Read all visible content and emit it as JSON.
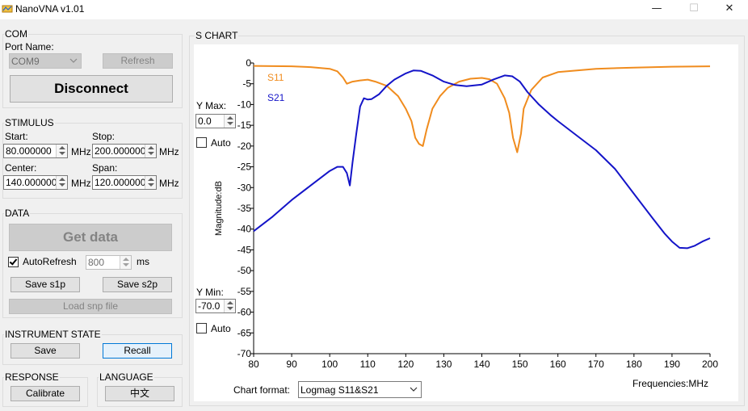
{
  "window": {
    "title": "NanoVNA v1.01",
    "controls": {
      "minimize": "—",
      "maximize": "☐",
      "close": "✕"
    }
  },
  "com": {
    "group": "COM",
    "port_label": "Port Name:",
    "port_value": "COM9",
    "refresh_label": "Refresh",
    "connect_label": "Disconnect"
  },
  "stimulus": {
    "group": "STIMULUS",
    "start_label": "Start:",
    "start_value": "80.000000",
    "stop_label": "Stop:",
    "stop_value": "200.000000",
    "center_label": "Center:",
    "center_value": "140.000000",
    "span_label": "Span:",
    "span_value": "120.000000",
    "unit": "MHz"
  },
  "data_group": {
    "group": "DATA",
    "get_data_label": "Get data",
    "autorefresh_label": "AutoRefresh",
    "autorefresh_checked": true,
    "interval_value": "800",
    "interval_unit": "ms",
    "save_s1p_label": "Save s1p",
    "save_s2p_label": "Save s2p",
    "load_snp_label": "Load snp file"
  },
  "instrument": {
    "group": "INSTRUMENT STATE",
    "save_label": "Save",
    "recall_label": "Recall"
  },
  "response": {
    "group": "RESPONSE",
    "calibrate_label": "Calibrate"
  },
  "language": {
    "group": "LANGUAGE",
    "button_label": "中文"
  },
  "schart": {
    "group": "S CHART",
    "ymax_label": "Y Max:",
    "ymax_value": "0.0",
    "ymin_label": "Y Min:",
    "ymin_value": "-70.0",
    "auto_label": "Auto",
    "chart_format_label": "Chart format:",
    "chart_format_value": "Logmag S11&S21"
  },
  "chart_data": {
    "type": "line",
    "title": "",
    "xlabel": "Frequencies:MHz",
    "ylabel": "Magnitude:dB",
    "xlim": [
      80,
      200
    ],
    "ylim": [
      -70,
      0
    ],
    "x_ticks": [
      80,
      90,
      100,
      110,
      120,
      130,
      140,
      150,
      160,
      170,
      180,
      190,
      200
    ],
    "y_ticks": [
      0,
      -5,
      -10,
      -15,
      -20,
      -25,
      -30,
      -35,
      -40,
      -45,
      -50,
      -55,
      -60,
      -65,
      -70
    ],
    "grid": false,
    "legend": "top-left",
    "series": [
      {
        "name": "S11",
        "color": "#f08c1e",
        "points": [
          [
            80,
            -0.7
          ],
          [
            90,
            -0.8
          ],
          [
            95,
            -1.0
          ],
          [
            100,
            -1.4
          ],
          [
            102,
            -2.0
          ],
          [
            103.5,
            -3.5
          ],
          [
            104.5,
            -5.0
          ],
          [
            106,
            -4.5
          ],
          [
            108,
            -4.2
          ],
          [
            110,
            -4.0
          ],
          [
            112,
            -4.5
          ],
          [
            115,
            -5.5
          ],
          [
            118,
            -8.0
          ],
          [
            120,
            -11.0
          ],
          [
            121.5,
            -14.0
          ],
          [
            122.5,
            -18.0
          ],
          [
            123.5,
            -19.5
          ],
          [
            124.5,
            -20.0
          ],
          [
            125.5,
            -16.0
          ],
          [
            127,
            -11.0
          ],
          [
            129,
            -8.0
          ],
          [
            131,
            -6.0
          ],
          [
            134,
            -4.5
          ],
          [
            137,
            -3.8
          ],
          [
            140,
            -3.6
          ],
          [
            142,
            -3.9
          ],
          [
            144,
            -5.0
          ],
          [
            146,
            -8.5
          ],
          [
            147.2,
            -12.0
          ],
          [
            148.2,
            -18.0
          ],
          [
            149.3,
            -21.5
          ],
          [
            150.3,
            -17.0
          ],
          [
            151,
            -11.0
          ],
          [
            153,
            -6.5
          ],
          [
            156,
            -3.5
          ],
          [
            160,
            -2.2
          ],
          [
            170,
            -1.4
          ],
          [
            180,
            -1.1
          ],
          [
            190,
            -0.9
          ],
          [
            200,
            -0.8
          ]
        ]
      },
      {
        "name": "S21",
        "color": "#1414c8",
        "points": [
          [
            80,
            -40.5
          ],
          [
            85,
            -37.0
          ],
          [
            90,
            -33.0
          ],
          [
            95,
            -29.5
          ],
          [
            100,
            -26.0
          ],
          [
            102,
            -25.0
          ],
          [
            103.5,
            -25.0
          ],
          [
            104.5,
            -26.5
          ],
          [
            105.3,
            -29.5
          ],
          [
            106,
            -24.0
          ],
          [
            107,
            -17.0
          ],
          [
            108,
            -10.5
          ],
          [
            109,
            -8.5
          ],
          [
            110,
            -8.8
          ],
          [
            111,
            -8.7
          ],
          [
            113,
            -7.5
          ],
          [
            115,
            -5.5
          ],
          [
            117,
            -4.0
          ],
          [
            120,
            -2.5
          ],
          [
            122,
            -1.8
          ],
          [
            124,
            -1.9
          ],
          [
            127,
            -3.0
          ],
          [
            130,
            -4.5
          ],
          [
            133,
            -5.3
          ],
          [
            136,
            -5.6
          ],
          [
            140,
            -5.2
          ],
          [
            143,
            -4.0
          ],
          [
            146,
            -3.0
          ],
          [
            148,
            -3.2
          ],
          [
            150,
            -4.5
          ],
          [
            152,
            -7.0
          ],
          [
            155,
            -10.0
          ],
          [
            158,
            -12.5
          ],
          [
            160,
            -14.0
          ],
          [
            165,
            -17.5
          ],
          [
            170,
            -21.0
          ],
          [
            175,
            -25.5
          ],
          [
            180,
            -31.5
          ],
          [
            185,
            -37.5
          ],
          [
            188,
            -41.0
          ],
          [
            190,
            -43.0
          ],
          [
            192,
            -44.5
          ],
          [
            194,
            -44.6
          ],
          [
            196,
            -44.0
          ],
          [
            198,
            -43.0
          ],
          [
            200,
            -42.2
          ]
        ]
      }
    ]
  }
}
